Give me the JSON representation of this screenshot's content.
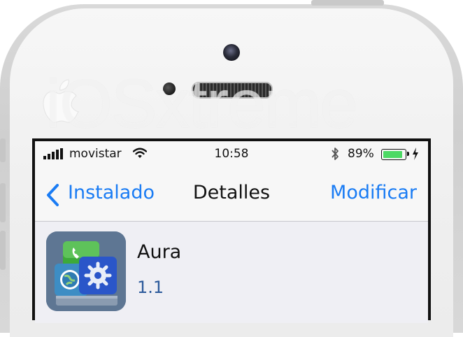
{
  "watermark": {
    "text": "iOSxtreme"
  },
  "status_bar": {
    "carrier": "movistar",
    "time": "10:58",
    "battery_percent": "89%",
    "battery_level": 0.89,
    "icons": [
      "signal-icon",
      "wifi-icon",
      "bluetooth-icon",
      "battery-icon",
      "charging-icon"
    ]
  },
  "nav": {
    "back_label": "Instalado",
    "title": "Detalles",
    "edit_label": "Modificar"
  },
  "app": {
    "name": "Aura",
    "version": "1.1",
    "icon": "aura-app-icon"
  },
  "colors": {
    "accent": "#1a7cf4",
    "battery_fill": "#4cd964",
    "version_text": "#2c5a9b",
    "background": "#efeff4"
  }
}
